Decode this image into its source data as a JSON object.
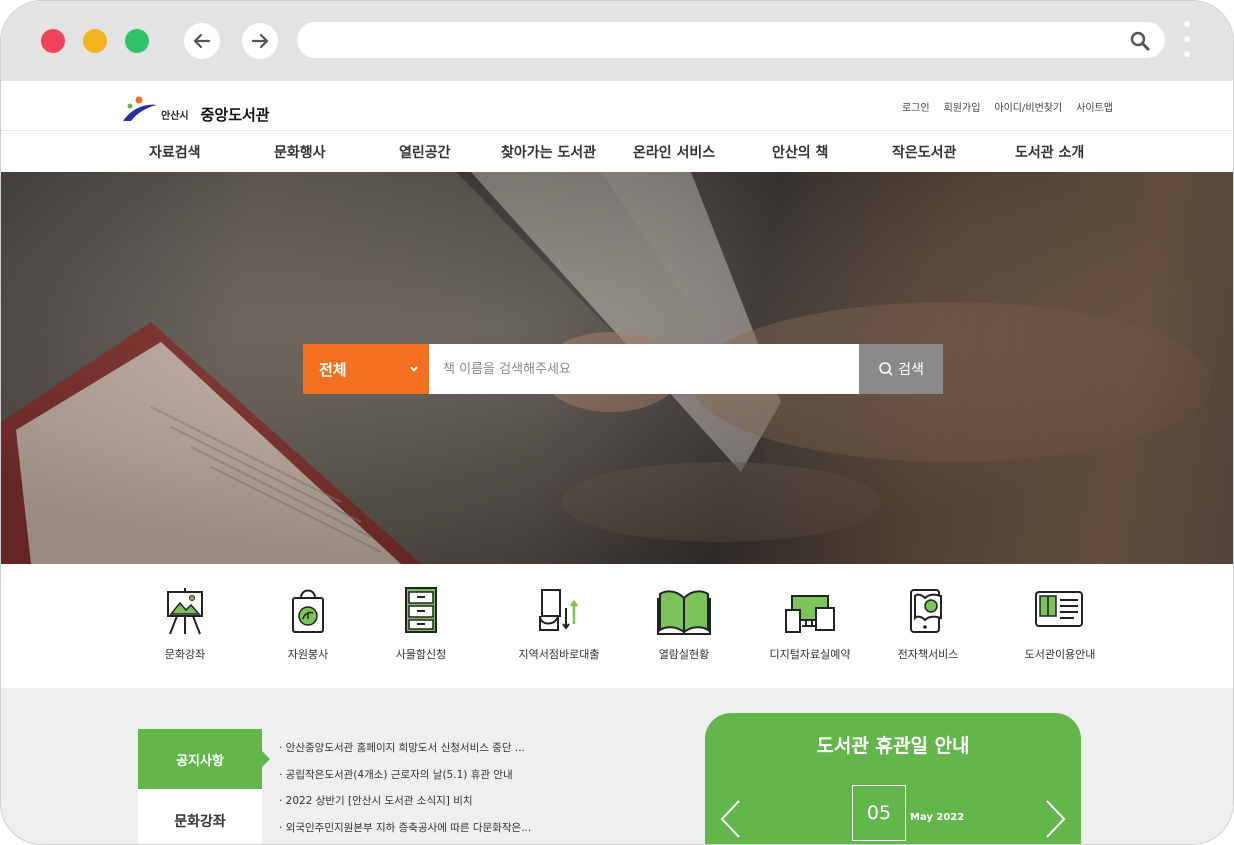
{
  "colors": {
    "accent_orange": "#f37021",
    "accent_green": "#63b64b",
    "search_button_gray": "#8a8a8a",
    "chrome_red": "#f0435a",
    "chrome_yellow": "#f5b31f",
    "chrome_green": "#2fc06a"
  },
  "browser": {
    "back_icon": "arrow-left-icon",
    "forward_icon": "arrow-right-icon",
    "search_icon": "search-icon",
    "menu_icon": "kebab-menu-icon",
    "url": ""
  },
  "header": {
    "logo_city": "안산시",
    "logo_name": "중앙도서관",
    "util_links": [
      "로그인",
      "회원가입",
      "아이디/비번찾기",
      "사이트맵"
    ]
  },
  "gnb": [
    "자료검색",
    "문화행사",
    "열린공간",
    "찾아가는 도서관",
    "온라인 서비스",
    "안산의 책",
    "작은도서관",
    "도서관 소개"
  ],
  "search": {
    "category": "전체",
    "placeholder": "책 이름을 검색해주세요",
    "button_label": "검색"
  },
  "quick_menu": [
    {
      "label": "문화강좌",
      "icon": "easel-icon"
    },
    {
      "label": "자원봉사",
      "icon": "eco-bag-icon"
    },
    {
      "label": "사물함신청",
      "icon": "locker-icon"
    },
    {
      "label": "지역서점바로대출",
      "icon": "book-exchange-icon"
    },
    {
      "label": "열람실현황",
      "icon": "open-book-icon"
    },
    {
      "label": "디지털자료실예약",
      "icon": "devices-icon"
    },
    {
      "label": "전자책서비스",
      "icon": "ebook-tablet-icon"
    },
    {
      "label": "도서관이용안내",
      "icon": "library-guide-icon"
    }
  ],
  "board": {
    "tabs": [
      "공지사항",
      "문화강좌"
    ],
    "notices": [
      "· 안산중앙도서관 홈페이지 희망도서 신청서비스 중단 ...",
      "· 공립작은도서관(4개소) 근로자의 날(5.1) 휴관 안내",
      "· 2022 상반기 [안산시 도서관 소식지] 비치",
      "· 외국인주민지원본부 지하 증축공사에 따른 다문화작은..."
    ]
  },
  "holiday": {
    "title": "도서관 휴관일 안내",
    "day": "05",
    "month": "May 2022"
  }
}
